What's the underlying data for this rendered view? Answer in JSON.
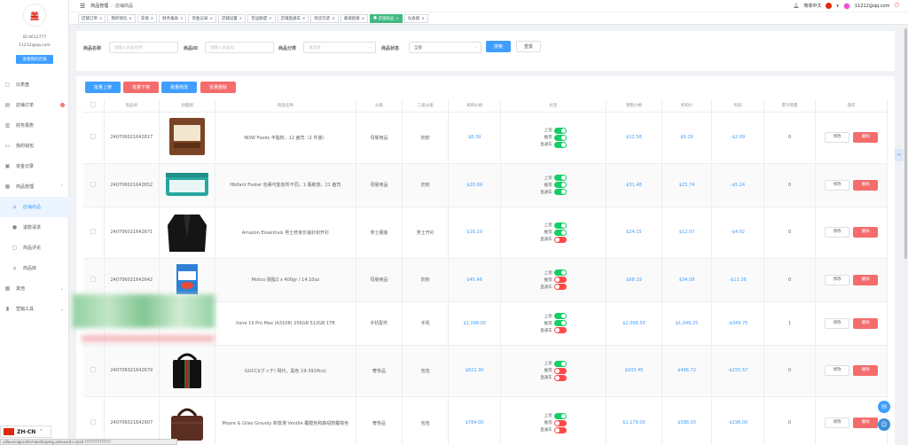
{
  "sidebar": {
    "logo_char": "盖",
    "user_id": "ID:4612777",
    "email": "11212@qq.com",
    "store_button": "查看我的店铺",
    "items": [
      {
        "label": "仪表盘",
        "icon": "dashboard-icon"
      },
      {
        "label": "店铺订单",
        "icon": "order-icon",
        "badge": "!"
      },
      {
        "label": "财务报表",
        "icon": "report-icon"
      },
      {
        "label": "我的钱包",
        "icon": "wallet-icon"
      },
      {
        "label": "资金记录",
        "icon": "funds-icon"
      },
      {
        "label": "商品管理",
        "icon": "goods-icon"
      },
      {
        "label": "店铺商品",
        "icon": "shop-icon"
      },
      {
        "label": "退款请求",
        "icon": "refund-icon"
      },
      {
        "label": "商品评论",
        "icon": "comment-icon"
      },
      {
        "label": "商品库",
        "icon": "library-icon"
      },
      {
        "label": "其他",
        "icon": "grid-icon"
      },
      {
        "label": "营销工具",
        "icon": "chart-icon"
      }
    ]
  },
  "header": {
    "breadcrumb_1": "商品管理",
    "breadcrumb_sep": "/",
    "breadcrumb_2": "店铺商品",
    "language": "简体中文",
    "user_email": "11212@qq.com"
  },
  "tabs": [
    {
      "label": "店铺订单"
    },
    {
      "label": "我的钱包"
    },
    {
      "label": "充值"
    },
    {
      "label": "财务报表"
    },
    {
      "label": "资金记录"
    },
    {
      "label": "店铺设置"
    },
    {
      "label": "货运联盟"
    },
    {
      "label": "店铺直通车"
    },
    {
      "label": "购买历史"
    },
    {
      "label": "邀请链接"
    },
    {
      "label": "店铺商品",
      "active": true
    },
    {
      "label": "仪表盘"
    }
  ],
  "filter": {
    "name_label": "商品名称",
    "name_placeholder": "请输入商品名称",
    "id_label": "商品ID",
    "id_placeholder": "请输入商品ID",
    "category_label": "商品分类",
    "category_placeholder": "请选择",
    "status_label": "商品状态",
    "status_value": "全部",
    "search_button": "搜索",
    "reset_button": "重置"
  },
  "actions": {
    "batch_on": "批量上架",
    "batch_off": "批量下架",
    "batch_edit": "批量修改",
    "batch_delete": "批量删除"
  },
  "table": {
    "headers": [
      "商品ID",
      "封面图",
      "商品名称",
      "分类",
      "二级分类",
      "采购价格",
      "标签",
      "销售价格",
      "折扣价",
      "利润",
      "累计销量",
      "操作"
    ],
    "tag_labels": {
      "on_shelf": "上架",
      "recommend": "推荐",
      "express": "直通车"
    },
    "edit_label": "修改",
    "delete_label": "删除",
    "rows": [
      {
        "id": "240706021642817",
        "name": "NOW Foods 丰脂粉，12 盎司（2 件装）",
        "category": "母婴用品",
        "subcategory": "奶粉",
        "purchase": "$8.39",
        "on_shelf": true,
        "recommend": true,
        "express": true,
        "sale": "$12.58",
        "discount": "$6.29",
        "profit": "-$2.09",
        "sold": "0",
        "img": "powder-bag"
      },
      {
        "id": "240706021642652",
        "name": "Hbifant Footer 包裹可能有所不同，1 瓶敏感，21 盎司",
        "category": "母婴用品",
        "subcategory": "奶粉",
        "purchase": "$20.99",
        "on_shelf": true,
        "recommend": true,
        "express": true,
        "sale": "$31.48",
        "discount": "$15.74",
        "profit": "-$5.24",
        "sold": "0",
        "img": "formula-tub"
      },
      {
        "id": "240706021642671",
        "name": "Amazon Essentials 男士修身长袖针织开衫",
        "category": "男士服装",
        "subcategory": "男士开衫",
        "purchase": "$16.10",
        "on_shelf": true,
        "recommend": true,
        "express": false,
        "sale": "$24.15",
        "discount": "$12.07",
        "profit": "-$4.02",
        "sold": "0",
        "img": "cardigan"
      },
      {
        "id": "240706021642642",
        "name": "Molico 脱脂3 x 400gr / 14.10oz",
        "category": "母婴用品",
        "subcategory": "奶粉",
        "purchase": "$45.46",
        "on_shelf": true,
        "recommend": false,
        "express": false,
        "sale": "$68.19",
        "discount": "$34.09",
        "profit": "-$11.36",
        "sold": "0",
        "img": "milk-box"
      },
      {
        "id": "",
        "name": "hone 15 Pro Max (A3108) 256GB 512GB 1TB",
        "category": "手机配件",
        "subcategory": "手机",
        "purchase": "$1,399.00",
        "on_shelf": true,
        "recommend": true,
        "express": false,
        "sale": "$2,098.50",
        "discount": "$1,049.25",
        "profit": "-$349.75",
        "sold": "1",
        "img": "phone"
      },
      {
        "id": "240706021642679",
        "name": "GUCCI(グッチ) 現代，黑色 19-391ffcx)",
        "category": "奢侈品",
        "subcategory": "包包",
        "purchase": "$622.30",
        "on_shelf": true,
        "recommend": false,
        "express": false,
        "sale": "$933.45",
        "discount": "$466.72",
        "profit": "-$155.57",
        "sold": "0",
        "img": "black-bag"
      },
      {
        "id": "240706021642907",
        "name": "Moore & Giles Gravely 新款港 Ventile 覆膜色和森绍蔚覆棕色",
        "category": "奢侈品",
        "subcategory": "包包",
        "purchase": "$784.00",
        "on_shelf": true,
        "recommend": false,
        "express": false,
        "sale": "$1,176.00",
        "discount": "$588.00",
        "profit": "-$196.00",
        "sold": "0",
        "img": "brown-bag"
      }
    ]
  },
  "footer": {
    "lang_code": "ZH-CN",
    "status_url": "ulllauncsgocsthchakofoxpmg.oxtsusolt.s.oksll.??????????????"
  }
}
